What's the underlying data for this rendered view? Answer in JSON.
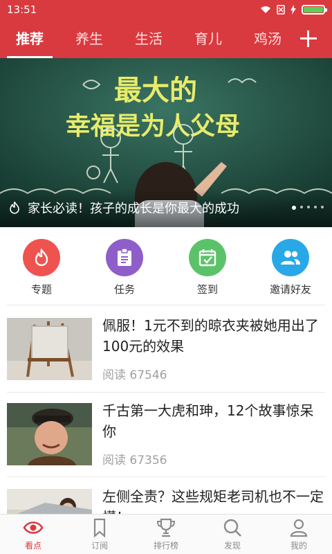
{
  "status": {
    "time": "13:51",
    "battery_level": 1.0
  },
  "tabs": [
    {
      "label": "推荐",
      "active": true
    },
    {
      "label": "养生",
      "active": false
    },
    {
      "label": "生活",
      "active": false
    },
    {
      "label": "育儿",
      "active": false
    },
    {
      "label": "鸡汤",
      "active": false
    }
  ],
  "banner": {
    "caption": "家长必读！孩子的成长是你最大的成功",
    "chalk_line1": "最大的",
    "chalk_line2": "幸福是为人父母",
    "slides": 5,
    "active_slide": 1
  },
  "quick_actions": [
    {
      "label": "专题",
      "icon": "flame-icon",
      "color": "#ef5350"
    },
    {
      "label": "任务",
      "icon": "clipboard-icon",
      "color": "#8e5fc9"
    },
    {
      "label": "签到",
      "icon": "calendar-check-icon",
      "color": "#5cc26a"
    },
    {
      "label": "邀请好友",
      "icon": "people-icon",
      "color": "#29a8e8"
    }
  ],
  "articles": [
    {
      "title": "佩服！1元不到的晾衣夹被她用出了100元的效果",
      "meta": "阅读 67546",
      "thumb": "easel-image"
    },
    {
      "title": "千古第一大虎和珅，12个故事惊呆你",
      "meta": "阅读 67356",
      "thumb": "portrait-image"
    },
    {
      "title": "左侧全责？这些规矩老司机也不一定懂！",
      "meta": "",
      "thumb": "car-image"
    }
  ],
  "bottom_nav": [
    {
      "label": "看点",
      "icon": "eye-icon",
      "active": true
    },
    {
      "label": "订阅",
      "icon": "bookmark-icon",
      "active": false
    },
    {
      "label": "排行榜",
      "icon": "trophy-icon",
      "active": false
    },
    {
      "label": "发现",
      "icon": "search-icon",
      "active": false
    },
    {
      "label": "我的",
      "icon": "user-icon",
      "active": false
    }
  ],
  "colors": {
    "brand": "#d93a3f",
    "nav_active": "#d93a3f",
    "nav_inactive": "#8a8a8a"
  }
}
